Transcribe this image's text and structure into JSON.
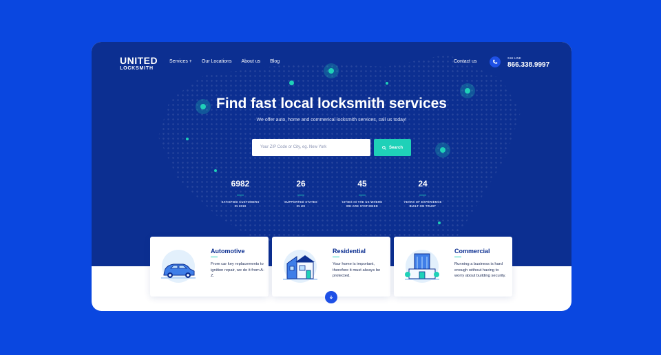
{
  "logo": {
    "line1": "UNITED",
    "line2": "LOCKSMITH"
  },
  "nav": {
    "items": [
      {
        "label": "Services  +"
      },
      {
        "label": "Our Locations"
      },
      {
        "label": "About us"
      },
      {
        "label": "Blog"
      }
    ],
    "contact": "Contact us",
    "phone_label": "24H LINE",
    "phone": "866.338.9997"
  },
  "hero": {
    "headline": "Find fast local locksmith services",
    "subtitle": "We offer auto, home and commerical locksmith services, call us today!",
    "search_placeholder": "Your ZIP Code or City, eg. New York",
    "search_button": "Search"
  },
  "stats": [
    {
      "value": "6982",
      "label_line1": "SATISFIED CUSTOMERS",
      "label_line2": "IN 2019"
    },
    {
      "value": "26",
      "label_line1": "SUPPORTED STATES",
      "label_line2": "IN US"
    },
    {
      "value": "45",
      "label_line1": "CITIES IN THE US WHERE",
      "label_line2": "WE ARE STATIONED"
    },
    {
      "value": "24",
      "label_line1": "YEARS OF EXPERIENCE",
      "label_line2": "BUILT ON TRUST"
    }
  ],
  "services": [
    {
      "title": "Automotive",
      "description": "From car key replacements to ignition repair, we do it from A-Z."
    },
    {
      "title": "Residential",
      "description": "Your home is important, therefore it must always be protected."
    },
    {
      "title": "Commercial",
      "description": "Running a business is hard enough without having to worry about building security."
    }
  ],
  "colors": {
    "background": "#0a47e0",
    "hero": "#0c2f91",
    "accent": "#1fd1b8",
    "button_blue": "#1e50e6"
  },
  "icons": {
    "phone": "phone-icon",
    "search": "search-icon",
    "scroll": "arrow-down-icon"
  }
}
